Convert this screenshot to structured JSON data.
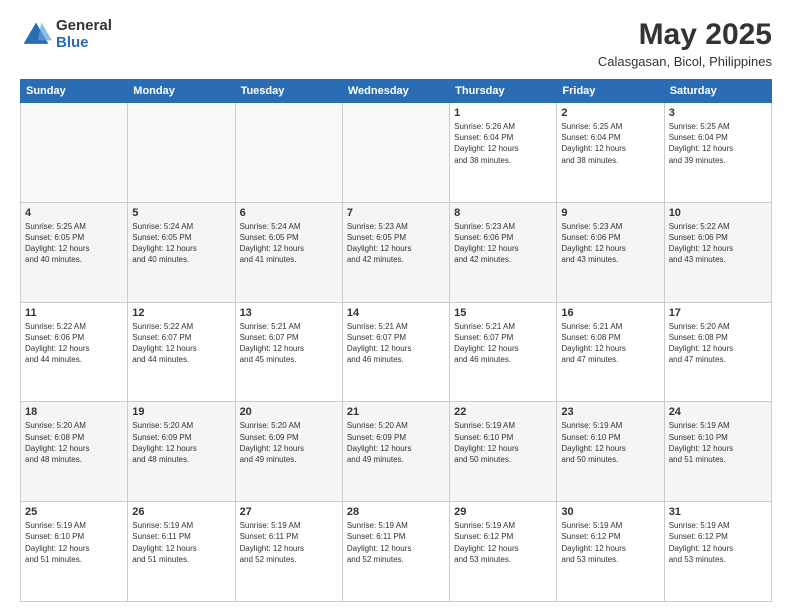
{
  "logo": {
    "general": "General",
    "blue": "Blue"
  },
  "header": {
    "month_year": "May 2025",
    "location": "Calasgasan, Bicol, Philippines"
  },
  "days_of_week": [
    "Sunday",
    "Monday",
    "Tuesday",
    "Wednesday",
    "Thursday",
    "Friday",
    "Saturday"
  ],
  "weeks": [
    [
      {
        "day": "",
        "info": ""
      },
      {
        "day": "",
        "info": ""
      },
      {
        "day": "",
        "info": ""
      },
      {
        "day": "",
        "info": ""
      },
      {
        "day": "1",
        "info": "Sunrise: 5:26 AM\nSunset: 6:04 PM\nDaylight: 12 hours\nand 38 minutes."
      },
      {
        "day": "2",
        "info": "Sunrise: 5:25 AM\nSunset: 6:04 PM\nDaylight: 12 hours\nand 38 minutes."
      },
      {
        "day": "3",
        "info": "Sunrise: 5:25 AM\nSunset: 6:04 PM\nDaylight: 12 hours\nand 39 minutes."
      }
    ],
    [
      {
        "day": "4",
        "info": "Sunrise: 5:25 AM\nSunset: 6:05 PM\nDaylight: 12 hours\nand 40 minutes."
      },
      {
        "day": "5",
        "info": "Sunrise: 5:24 AM\nSunset: 6:05 PM\nDaylight: 12 hours\nand 40 minutes."
      },
      {
        "day": "6",
        "info": "Sunrise: 5:24 AM\nSunset: 6:05 PM\nDaylight: 12 hours\nand 41 minutes."
      },
      {
        "day": "7",
        "info": "Sunrise: 5:23 AM\nSunset: 6:05 PM\nDaylight: 12 hours\nand 42 minutes."
      },
      {
        "day": "8",
        "info": "Sunrise: 5:23 AM\nSunset: 6:06 PM\nDaylight: 12 hours\nand 42 minutes."
      },
      {
        "day": "9",
        "info": "Sunrise: 5:23 AM\nSunset: 6:06 PM\nDaylight: 12 hours\nand 43 minutes."
      },
      {
        "day": "10",
        "info": "Sunrise: 5:22 AM\nSunset: 6:06 PM\nDaylight: 12 hours\nand 43 minutes."
      }
    ],
    [
      {
        "day": "11",
        "info": "Sunrise: 5:22 AM\nSunset: 6:06 PM\nDaylight: 12 hours\nand 44 minutes."
      },
      {
        "day": "12",
        "info": "Sunrise: 5:22 AM\nSunset: 6:07 PM\nDaylight: 12 hours\nand 44 minutes."
      },
      {
        "day": "13",
        "info": "Sunrise: 5:21 AM\nSunset: 6:07 PM\nDaylight: 12 hours\nand 45 minutes."
      },
      {
        "day": "14",
        "info": "Sunrise: 5:21 AM\nSunset: 6:07 PM\nDaylight: 12 hours\nand 46 minutes."
      },
      {
        "day": "15",
        "info": "Sunrise: 5:21 AM\nSunset: 6:07 PM\nDaylight: 12 hours\nand 46 minutes."
      },
      {
        "day": "16",
        "info": "Sunrise: 5:21 AM\nSunset: 6:08 PM\nDaylight: 12 hours\nand 47 minutes."
      },
      {
        "day": "17",
        "info": "Sunrise: 5:20 AM\nSunset: 6:08 PM\nDaylight: 12 hours\nand 47 minutes."
      }
    ],
    [
      {
        "day": "18",
        "info": "Sunrise: 5:20 AM\nSunset: 6:08 PM\nDaylight: 12 hours\nand 48 minutes."
      },
      {
        "day": "19",
        "info": "Sunrise: 5:20 AM\nSunset: 6:09 PM\nDaylight: 12 hours\nand 48 minutes."
      },
      {
        "day": "20",
        "info": "Sunrise: 5:20 AM\nSunset: 6:09 PM\nDaylight: 12 hours\nand 49 minutes."
      },
      {
        "day": "21",
        "info": "Sunrise: 5:20 AM\nSunset: 6:09 PM\nDaylight: 12 hours\nand 49 minutes."
      },
      {
        "day": "22",
        "info": "Sunrise: 5:19 AM\nSunset: 6:10 PM\nDaylight: 12 hours\nand 50 minutes."
      },
      {
        "day": "23",
        "info": "Sunrise: 5:19 AM\nSunset: 6:10 PM\nDaylight: 12 hours\nand 50 minutes."
      },
      {
        "day": "24",
        "info": "Sunrise: 5:19 AM\nSunset: 6:10 PM\nDaylight: 12 hours\nand 51 minutes."
      }
    ],
    [
      {
        "day": "25",
        "info": "Sunrise: 5:19 AM\nSunset: 6:10 PM\nDaylight: 12 hours\nand 51 minutes."
      },
      {
        "day": "26",
        "info": "Sunrise: 5:19 AM\nSunset: 6:11 PM\nDaylight: 12 hours\nand 51 minutes."
      },
      {
        "day": "27",
        "info": "Sunrise: 5:19 AM\nSunset: 6:11 PM\nDaylight: 12 hours\nand 52 minutes."
      },
      {
        "day": "28",
        "info": "Sunrise: 5:19 AM\nSunset: 6:11 PM\nDaylight: 12 hours\nand 52 minutes."
      },
      {
        "day": "29",
        "info": "Sunrise: 5:19 AM\nSunset: 6:12 PM\nDaylight: 12 hours\nand 53 minutes."
      },
      {
        "day": "30",
        "info": "Sunrise: 5:19 AM\nSunset: 6:12 PM\nDaylight: 12 hours\nand 53 minutes."
      },
      {
        "day": "31",
        "info": "Sunrise: 5:19 AM\nSunset: 6:12 PM\nDaylight: 12 hours\nand 53 minutes."
      }
    ]
  ]
}
